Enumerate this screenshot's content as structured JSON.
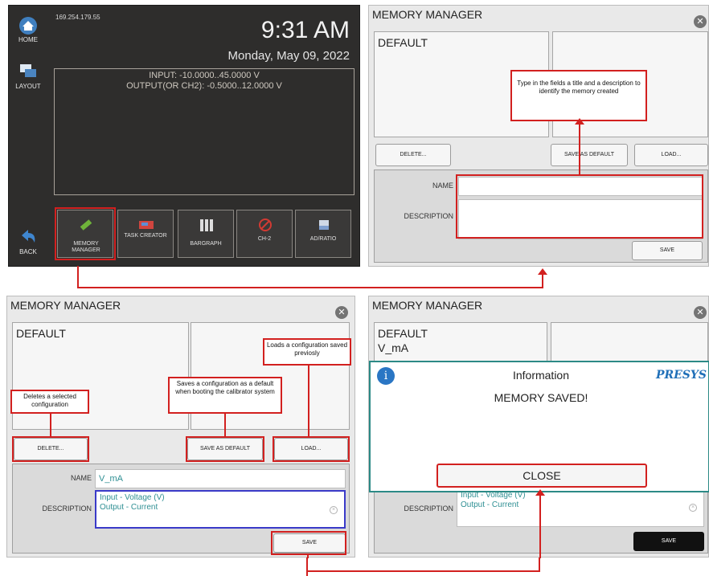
{
  "panel1": {
    "ip_address": "169.254.179.55",
    "time": "9:31 AM",
    "date": "Monday, May 09, 2022",
    "input_line": "INPUT: -10.0000..45.0000 V",
    "output_line": "OUTPUT(OR CH2): -0.5000..12.0000 V",
    "sidebar": {
      "home": "HOME",
      "layout": "LAYOUT",
      "back": "BACK"
    },
    "tiles": [
      "MEMORY MANAGER",
      "TASK CREATOR",
      "BARGRAPH",
      "CH-2",
      "AD/RATIO"
    ]
  },
  "memory_manager": {
    "title": "MEMORY MANAGER",
    "default_item": "DEFAULT",
    "saved_item": "V_mA",
    "buttons": {
      "delete": "DELETE...",
      "save_as_default": "SAVE AS DEFAULT",
      "load": "LOAD...",
      "save": "SAVE"
    },
    "labels": {
      "name": "NAME",
      "description": "DESCRIPTION"
    },
    "name_value": "V_mA",
    "description_line1": "Input - Voltage (V)",
    "description_line2": "Output - Current"
  },
  "callouts": {
    "type_fields": "Type in the fields a title and a description to identify the memory created",
    "delete": "Deletes a selected configuration",
    "save_default": "Saves a configuration as a default when booting the calibrator system",
    "load": "Loads a configuration saved previosly"
  },
  "dialog": {
    "title": "Information",
    "brand": "PRESYS",
    "message": "MEMORY SAVED!",
    "close": "CLOSE",
    "info_glyph": "i"
  },
  "colors": {
    "annotation_red": "#d2201f",
    "dialog_teal": "#2c8a86",
    "value_teal": "#2e8f93",
    "dark_screen": "#2e2d2c"
  }
}
